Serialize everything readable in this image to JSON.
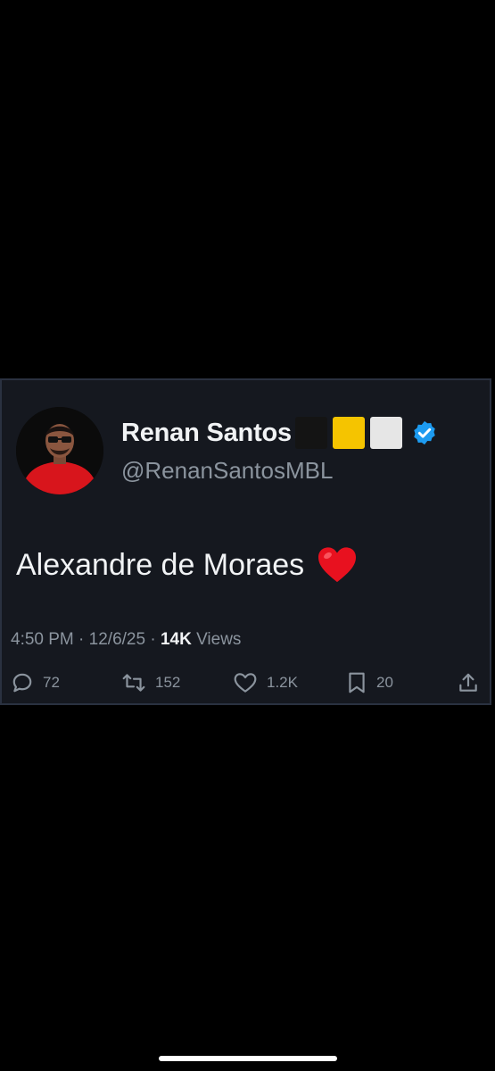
{
  "tweet": {
    "display_name": "Renan Santos",
    "handle": "@RenanSantosMBL",
    "text": "Alexandre de Moraes",
    "time": "4:50 PM",
    "separator1": "·",
    "date": "12/6/25",
    "separator2": "·",
    "views_count": "14K",
    "views_label": "Views",
    "emoji_flags": [
      {
        "name": "black-square",
        "color": "#141414"
      },
      {
        "name": "yellow-square",
        "color": "#f5c400"
      },
      {
        "name": "white-square",
        "color": "#e6e6e6"
      }
    ],
    "verified": true,
    "verified_color": "#1d9bf0",
    "text_emoji": "red-heart-icon"
  },
  "actions": {
    "replies": "72",
    "reposts": "152",
    "likes": "1.2K",
    "bookmarks": "20",
    "share_icon": "share-icon"
  },
  "colors": {
    "page_background": "#000000",
    "card_background": "#15181f",
    "primary_text": "#f1f3f5",
    "secondary_text": "#8b949e",
    "avatar_shirt": "#d8151c"
  }
}
